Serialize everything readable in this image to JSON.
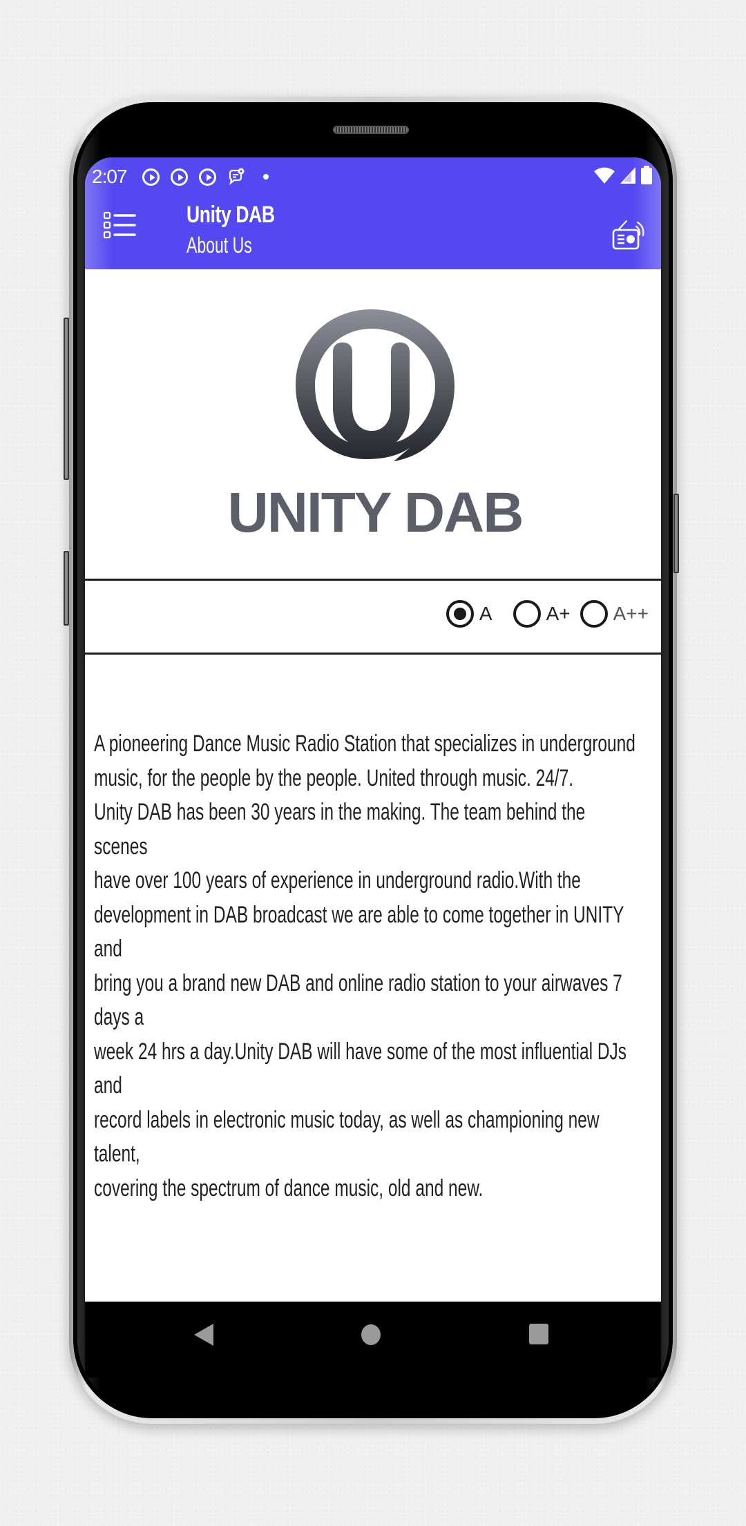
{
  "status_bar": {
    "time": "2:07",
    "notification_icons": [
      "play-circle-icon",
      "play-circle-icon",
      "play-circle-icon",
      "chat-bubble-icon",
      "dot-icon"
    ],
    "system_icons": [
      "wifi-icon",
      "cellular-signal-icon",
      "battery-icon"
    ]
  },
  "app_bar": {
    "title": "Unity DAB",
    "subtitle": "About Us",
    "menu_icon": "list-menu-icon",
    "action_icon": "radio-icon",
    "color": "#5449f1"
  },
  "logo": {
    "wordmark": "UNITY DAB",
    "color": "#5c5f69"
  },
  "text_size": {
    "options": [
      {
        "label": "A",
        "selected": true
      },
      {
        "label": "A+",
        "selected": false
      },
      {
        "label": "A++",
        "selected": false
      }
    ]
  },
  "about": {
    "lines": [
      "A pioneering Dance Music Radio Station that specializes in underground",
      "music, for the people by the people. United through music. 24/7.",
      "Unity DAB has been 30 years in the making. The team behind the",
      "scenes",
      "have over 100 years of experience in underground radio.With the",
      "development in DAB broadcast we are able to come together in UNITY",
      "and",
      "bring you a brand new DAB and online radio station to your airwaves 7",
      "days a",
      "week 24 hrs a day.Unity DAB will have some of the most influential DJs",
      "and",
      "record labels in electronic music today, as well as championing new",
      "talent,",
      "covering the spectrum of dance music, old and new."
    ]
  },
  "nav_bar": {
    "back": "back-icon",
    "home": "home-icon",
    "recents": "recents-icon"
  }
}
